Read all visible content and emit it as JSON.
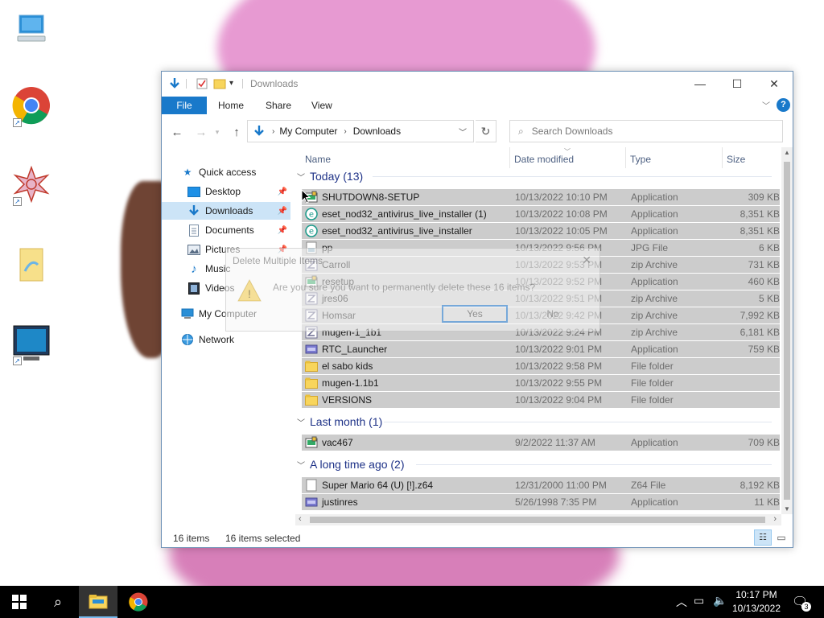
{
  "window": {
    "title": "Downloads",
    "ribbon_tabs": [
      "File",
      "Home",
      "Share",
      "View"
    ],
    "breadcrumb": [
      "My Computer",
      "Downloads"
    ],
    "search_placeholder": "Search Downloads",
    "columns": {
      "name": "Name",
      "date": "Date modified",
      "type": "Type",
      "size": "Size"
    }
  },
  "nav": {
    "quick_access": "Quick access",
    "items": [
      "Desktop",
      "Downloads",
      "Documents",
      "Pictures",
      "Music",
      "Videos"
    ],
    "my_computer": "My Computer",
    "network": "Network"
  },
  "groups": [
    {
      "label": "Today (13)",
      "files": [
        {
          "name": "SHUTDOWN8-SETUP",
          "date": "10/13/2022 10:10 PM",
          "type": "Application",
          "size": "309 KB",
          "icon": "setup-icon"
        },
        {
          "name": "eset_nod32_antivirus_live_installer (1)",
          "date": "10/13/2022 10:08 PM",
          "type": "Application",
          "size": "8,351 KB",
          "icon": "eset-icon"
        },
        {
          "name": "eset_nod32_antivirus_live_installer",
          "date": "10/13/2022 10:05 PM",
          "type": "Application",
          "size": "8,351 KB",
          "icon": "eset-icon"
        },
        {
          "name": "pp",
          "date": "10/13/2022 9:56 PM",
          "type": "JPG File",
          "size": "6 KB",
          "icon": "jpg-file-icon"
        },
        {
          "name": "Carroll",
          "date": "10/13/2022 9:53 PM",
          "type": "zip Archive",
          "size": "731 KB",
          "icon": "zip-icon"
        },
        {
          "name": "resetup",
          "date": "10/13/2022 9:52 PM",
          "type": "Application",
          "size": "460 KB",
          "icon": "setup-icon"
        },
        {
          "name": "jres06",
          "date": "10/13/2022 9:51 PM",
          "type": "zip Archive",
          "size": "5 KB",
          "icon": "zip-icon"
        },
        {
          "name": "Homsar",
          "date": "10/13/2022 9:42 PM",
          "type": "zip Archive",
          "size": "7,992 KB",
          "icon": "zip-icon"
        },
        {
          "name": "mugen-1_1b1",
          "date": "10/13/2022 9:24 PM",
          "type": "zip Archive",
          "size": "6,181 KB",
          "icon": "zip-icon"
        },
        {
          "name": "RTC_Launcher",
          "date": "10/13/2022 9:01 PM",
          "type": "Application",
          "size": "759 KB",
          "icon": "app-icon"
        },
        {
          "name": "el sabo kids",
          "date": "10/13/2022 9:58 PM",
          "type": "File folder",
          "size": "",
          "icon": "folder-icon"
        },
        {
          "name": "mugen-1.1b1",
          "date": "10/13/2022 9:55 PM",
          "type": "File folder",
          "size": "",
          "icon": "folder-icon"
        },
        {
          "name": "VERSIONS",
          "date": "10/13/2022 9:04 PM",
          "type": "File folder",
          "size": "",
          "icon": "folder-icon"
        }
      ]
    },
    {
      "label": "Last month (1)",
      "files": [
        {
          "name": "vac467",
          "date": "9/2/2022 11:37 AM",
          "type": "Application",
          "size": "709 KB",
          "icon": "setup-icon"
        }
      ]
    },
    {
      "label": "A long time ago (2)",
      "files": [
        {
          "name": "Super Mario 64 (U) [!].z64",
          "date": "12/31/2000 11:00 PM",
          "type": "Z64 File",
          "size": "8,192 KB",
          "icon": "blank-file-icon"
        },
        {
          "name": "justinres",
          "date": "5/26/1998 7:35 PM",
          "type": "Application",
          "size": "11 KB",
          "icon": "app-icon"
        }
      ]
    }
  ],
  "status": {
    "count": "16 items",
    "selected": "16 items selected"
  },
  "dialog": {
    "title": "Delete Multiple Items",
    "message": "Are you sure you want to permanently delete these 16 items?",
    "yes": "Yes",
    "no": "No"
  },
  "taskbar": {
    "time": "10:17 PM",
    "date": "10/13/2022",
    "notifications": "3"
  },
  "colors": {
    "accent": "#1979ca",
    "selection": "#cccccc",
    "nav_selected": "#cce4f7",
    "group_header": "#1e3287"
  }
}
